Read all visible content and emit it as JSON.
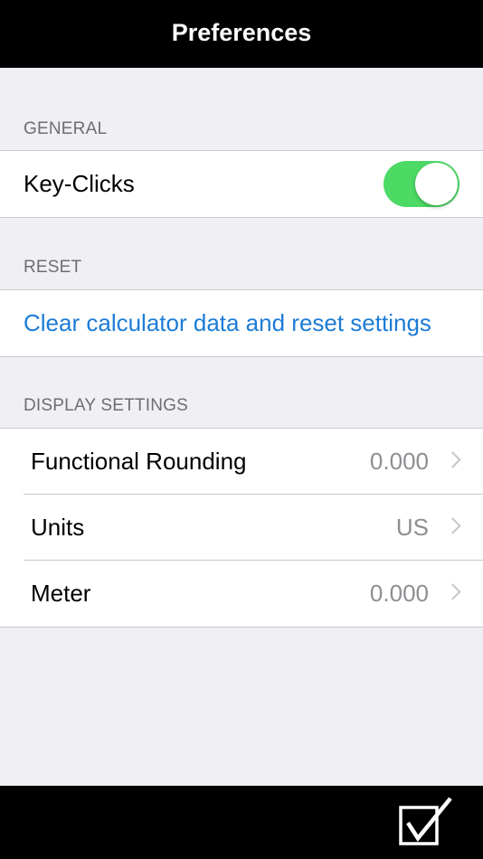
{
  "navbar": {
    "title": "Preferences"
  },
  "general": {
    "header": "GENERAL",
    "key_clicks_label": "Key-Clicks",
    "key_clicks_on": true
  },
  "reset": {
    "header": "RESET",
    "clear_label": "Clear calculator data and reset settings"
  },
  "display": {
    "header": "DISPLAY SETTINGS",
    "rows": [
      {
        "label": "Functional Rounding",
        "value": "0.000"
      },
      {
        "label": "Units",
        "value": "US"
      },
      {
        "label": "Meter",
        "value": "0.000"
      }
    ]
  },
  "colors": {
    "toggle_on": "#4cd964",
    "link": "#1c7cd5",
    "bar_background": "#000000",
    "page_background": "#efeff4"
  },
  "toolbar": {
    "done_icon": "checkbox-check-icon"
  }
}
